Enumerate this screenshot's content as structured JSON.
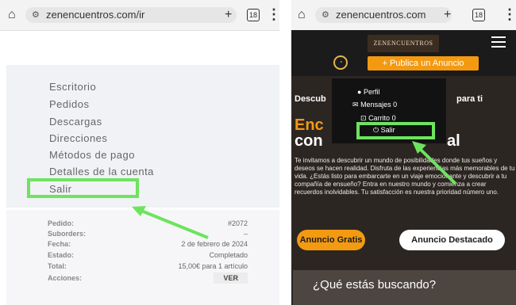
{
  "left_screen": {
    "browser": {
      "url": "zenencuentros.com/ir",
      "tab_count": "18"
    },
    "account_menu": [
      "Escritorio",
      "Pedidos",
      "Descargas",
      "Direcciones",
      "Métodos de pago",
      "Detalles de la cuenta",
      "Salir"
    ],
    "order": {
      "rows": [
        {
          "key": "Pedido:",
          "value": "#2072"
        },
        {
          "key": "Suborders:",
          "value": "–"
        },
        {
          "key": "Fecha:",
          "value": "2 de febrero de 2024"
        },
        {
          "key": "Estado:",
          "value": "Completado"
        },
        {
          "key": "Total:",
          "value": "15,00€ para 1 artículo"
        }
      ],
      "actions_label": "Acciones:",
      "view_button": "VER"
    }
  },
  "right_screen": {
    "browser": {
      "url": "zenencuentros.com",
      "tab_count": "18"
    },
    "logo": "ZENENCUENTROS",
    "publish_button": "+ Publica un Anuncio",
    "hero_fragments": [
      "Descub",
      "para ti",
      "Enc",
      "con",
      "al"
    ],
    "dropdown": [
      {
        "icon": "user-icon",
        "label": "Perfil",
        "count": ""
      },
      {
        "icon": "mail-icon",
        "label": "Mensajes",
        "count": "0"
      },
      {
        "icon": "cart-icon",
        "label": "Carrito",
        "count": "0"
      },
      {
        "icon": "power-icon",
        "label": "Salir",
        "count": ""
      }
    ],
    "body_copy": "Te invitamos a descubrir un mundo de posibilidades donde tus sueños y deseos se hacen realidad. Disfruta de las experiencias más memorables de tu vida. ¿Estás listo para embarcarte en un viaje emocionante y descubrir a tu compañía de ensueño? Entra en nuestro mundo y comienza a crear recuerdos inolvidables. Tu satisfacción es nuestra prioridad número uno.",
    "btn_anuncio_gratis": "Anuncio Gratis",
    "btn_anuncio_destacado": "Anuncio Destacado",
    "search_heading": "¿Qué estás buscando?"
  },
  "colors": {
    "highlight": "#6de45e",
    "accent": "#f39a12"
  }
}
